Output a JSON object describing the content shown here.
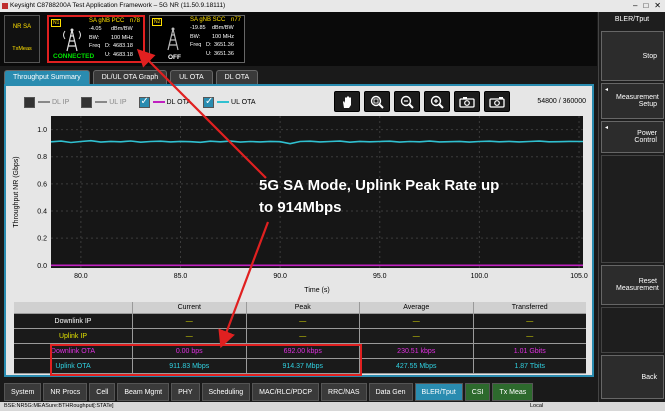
{
  "window": {
    "title": "Keysight C8788200A Test Application Framework – 5G NR (11.50.9.18111)"
  },
  "mode": {
    "line1": "NR SA",
    "line2": "TxMeas"
  },
  "cells": [
    {
      "tag": "N1",
      "name": "SA gNB PCC",
      "band": "n78",
      "power": "-4.05",
      "power_unit": "dBm/BW",
      "bw_label": "BW:",
      "bw_value": "100 MHz",
      "freq_label": "Freq",
      "d_label": "D:",
      "d_value": "4683.18",
      "u_label": "U:",
      "u_value": "4683.18",
      "status": "CONNECTED",
      "status_color": "#00e000"
    },
    {
      "tag": "N2",
      "name": "SA gNB SCC",
      "band": "n77",
      "power": "-19.85",
      "power_unit": "dBm/BW",
      "bw_label": "BW:",
      "bw_value": "100 MHz",
      "freq_label": "Freq",
      "d_label": "D:",
      "d_value": "3651.36",
      "u_label": "U:",
      "u_value": "3651.36",
      "status": "OFF",
      "status_color": "#ffffff"
    }
  ],
  "tabs": [
    {
      "label": "Throughput Summary",
      "active": true
    },
    {
      "label": "DL/UL OTA Graph",
      "active": false
    },
    {
      "label": "UL OTA",
      "active": false
    },
    {
      "label": "DL OTA",
      "active": false
    }
  ],
  "legend": [
    {
      "label": "DL IP",
      "checked": false,
      "color": "#888888"
    },
    {
      "label": "UL IP",
      "checked": false,
      "color": "#888888"
    },
    {
      "label": "DL OTA",
      "checked": true,
      "color": "#c020c0"
    },
    {
      "label": "UL OTA",
      "checked": true,
      "color": "#30c0d0"
    }
  ],
  "toolbar": {
    "icons": [
      "hand-pan-icon",
      "zoom-fit-icon",
      "zoom-out-icon",
      "zoom-in-icon",
      "camera-save-icon",
      "camera-copy-icon"
    ],
    "counter": "54800 / 360000"
  },
  "chart_data": {
    "type": "line",
    "xlabel": "Time (s)",
    "ylabel": "Throughput NR (Gbps)",
    "xlim": [
      78.5,
      105.2
    ],
    "ylim": [
      -0.02,
      1.1
    ],
    "xticks": [
      "80.0",
      "85.0",
      "90.0",
      "95.0",
      "100.0",
      "105.0"
    ],
    "yticks": [
      "0.0",
      "0.2",
      "0.4",
      "0.6",
      "0.8",
      "1.0"
    ],
    "grid": true,
    "series": [
      {
        "name": "UL OTA",
        "color": "#30c0d0",
        "x": [
          78.5,
          79,
          79.5,
          80,
          80.5,
          81,
          81.5,
          82,
          82.5,
          83,
          83.5,
          84,
          84.5,
          85,
          85.5,
          86,
          86.5,
          87,
          87.5,
          88,
          88.5,
          89,
          89.5,
          90,
          90.5,
          91,
          91.5,
          92,
          92.5,
          93,
          93.5,
          94,
          94.5,
          95,
          95.5,
          96,
          96.5,
          97,
          97.5,
          98,
          98.5,
          99,
          99.5,
          100,
          100.5,
          101,
          101.5,
          102,
          102.5,
          103,
          103.5,
          104,
          104.5,
          105.2
        ],
        "y": [
          0.91,
          0.915,
          0.905,
          0.912,
          0.918,
          0.908,
          0.913,
          0.91,
          0.916,
          0.907,
          0.912,
          0.914,
          0.909,
          0.913,
          0.911,
          0.906,
          0.914,
          0.91,
          0.915,
          0.908,
          0.912,
          0.909,
          0.913,
          0.911,
          0.896,
          0.912,
          0.914,
          0.909,
          0.912,
          0.915,
          0.907,
          0.913,
          0.91,
          0.912,
          0.914,
          0.908,
          0.912,
          0.91,
          0.915,
          0.909,
          0.911,
          0.913,
          0.908,
          0.912,
          0.914,
          0.91,
          0.913,
          0.909,
          0.912,
          0.915,
          0.91,
          0.911,
          0.913,
          0.912
        ]
      },
      {
        "name": "DL OTA",
        "color": "#c020c0",
        "x": [
          78.5,
          105.2
        ],
        "y": [
          0.0,
          0.0
        ]
      }
    ]
  },
  "table": {
    "headers": [
      "",
      "Current",
      "Peak",
      "Average",
      "Transferred"
    ],
    "rows": [
      {
        "name": "Downlink IP",
        "name_color": "#ffffff",
        "value_color": "#e0e000",
        "cells": [
          "—",
          "—",
          "—",
          "—"
        ]
      },
      {
        "name": "Uplink IP",
        "name_color": "#e0e000",
        "value_color": "#e0e000",
        "cells": [
          "—",
          "—",
          "—",
          "—"
        ]
      },
      {
        "name": "Downlink OTA",
        "name_color": "#e030e0",
        "value_color": "#e030e0",
        "cells": [
          "0.00 bps",
          "692.00 kbps",
          "230.51 kbps",
          "1.01 Gbits"
        ]
      },
      {
        "name": "Uplink OTA",
        "name_color": "#30d0e0",
        "value_color": "#30d0e0",
        "cells": [
          "911.83 Mbps",
          "914.37 Mbps",
          "427.55 Mbps",
          "1.87 Tbits"
        ]
      }
    ]
  },
  "bottom_tabs": [
    {
      "label": "System",
      "style": "normal"
    },
    {
      "label": "NR Procs",
      "style": "normal"
    },
    {
      "label": "Cell",
      "style": "normal"
    },
    {
      "label": "Beam Mgmt",
      "style": "normal"
    },
    {
      "label": "PHY",
      "style": "normal"
    },
    {
      "label": "Scheduling",
      "style": "normal"
    },
    {
      "label": "MAC/RLC/PDCP",
      "style": "normal"
    },
    {
      "label": "RRC/NAS",
      "style": "normal"
    },
    {
      "label": "Data Gen",
      "style": "normal"
    },
    {
      "label": "BLER/Tput",
      "style": "active"
    },
    {
      "label": "CSI",
      "style": "green"
    },
    {
      "label": "Tx Meas",
      "style": "green"
    }
  ],
  "statusbar": {
    "left": "BSE:NR5G:MEASure:BTHRoughput[:STATe]",
    "right": "Local"
  },
  "right_panel": {
    "title": "BLER/Tput",
    "buttons": [
      {
        "label": "Stop",
        "has_arrow": false
      },
      {
        "label": "Measurement Setup",
        "has_arrow": true
      },
      {
        "label": "Power Control",
        "has_arrow": true
      },
      {
        "label": "Reset Measurement",
        "has_arrow": false
      },
      {
        "label": "Back",
        "has_arrow": false
      }
    ]
  },
  "annotation": {
    "line1": "5G SA Mode, Uplink Peak Rate up",
    "line2": "to 914Mbps",
    "color": "#e02020"
  }
}
